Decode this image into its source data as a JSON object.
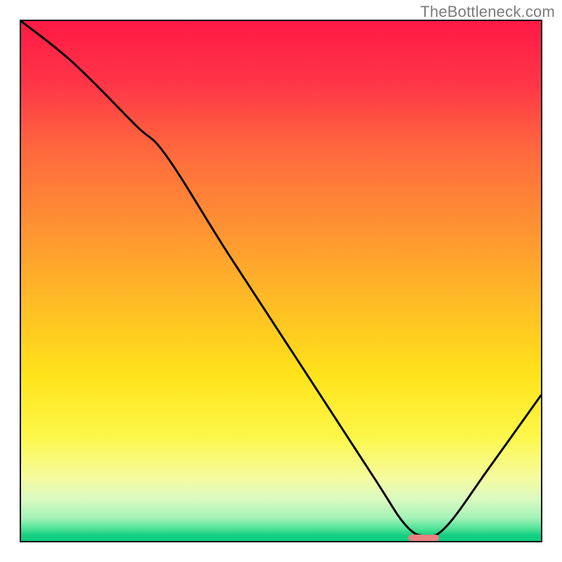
{
  "watermark": "TheBottleneck.com",
  "chart_data": {
    "type": "line",
    "title": "",
    "xlabel": "",
    "ylabel": "",
    "xlim": [
      0,
      100
    ],
    "ylim": [
      0,
      100
    ],
    "grid": false,
    "legend": false,
    "series": [
      {
        "name": "bottleneck-curve",
        "x": [
          0,
          10,
          22,
          28,
          40,
          55,
          68,
          74,
          78,
          82,
          90,
          100
        ],
        "values": [
          100,
          92,
          80,
          74,
          55,
          32,
          12,
          3,
          1,
          3,
          14,
          28
        ]
      }
    ],
    "marker": {
      "x_start": 74,
      "x_end": 80,
      "y": 1.2,
      "color": "#e8827f"
    },
    "background_gradient": {
      "stops": [
        {
          "t": 0.0,
          "color": "#ff1a45"
        },
        {
          "t": 0.12,
          "color": "#ff3648"
        },
        {
          "t": 0.25,
          "color": "#ff6a3e"
        },
        {
          "t": 0.4,
          "color": "#ff9433"
        },
        {
          "t": 0.55,
          "color": "#ffbf25"
        },
        {
          "t": 0.68,
          "color": "#ffe31a"
        },
        {
          "t": 0.8,
          "color": "#fdf84b"
        },
        {
          "t": 0.88,
          "color": "#f5fca1"
        },
        {
          "t": 0.92,
          "color": "#dafac1"
        },
        {
          "t": 0.955,
          "color": "#a6f3b8"
        },
        {
          "t": 0.975,
          "color": "#56e59a"
        },
        {
          "t": 0.99,
          "color": "#12cf81"
        },
        {
          "t": 1.0,
          "color": "#11cd80"
        }
      ]
    }
  }
}
